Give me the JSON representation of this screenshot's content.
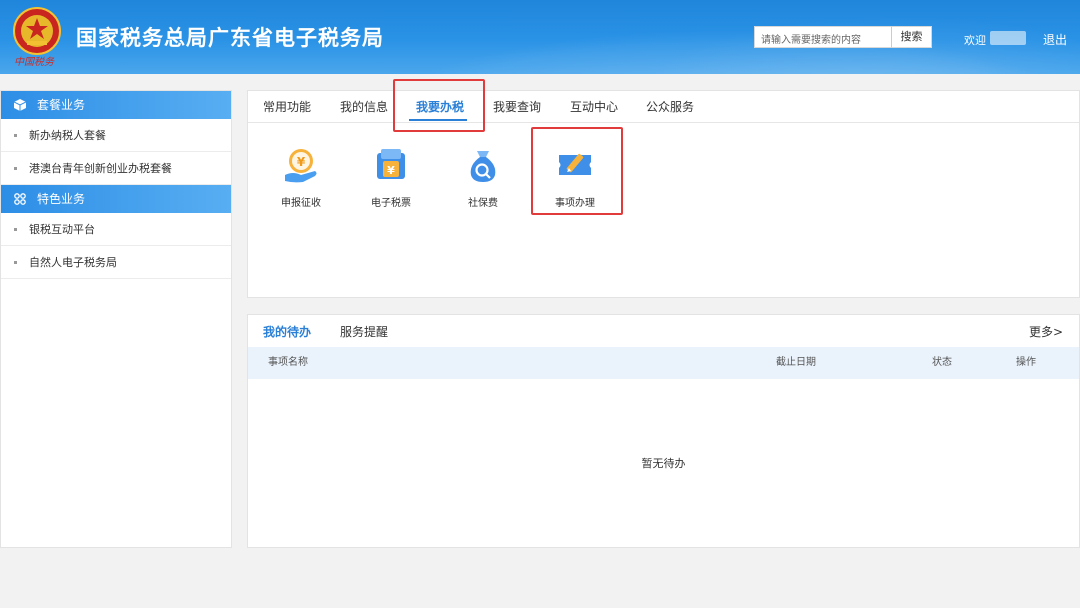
{
  "header": {
    "title": "国家税务总局广东省电子税务局",
    "search_placeholder": "请输入需要搜索的内容",
    "search_button": "搜索",
    "welcome": "欢迎",
    "logout": "退出",
    "emblem_caption": "中国税务"
  },
  "sidebar": {
    "sections": [
      {
        "title": "套餐业务",
        "icon": "cube-icon",
        "items": [
          "新办纳税人套餐",
          "港澳台青年创新创业办税套餐"
        ]
      },
      {
        "title": "特色业务",
        "icon": "grid-icon",
        "items": [
          "银税互动平台",
          "自然人电子税务局"
        ]
      }
    ]
  },
  "main": {
    "tabs": [
      "常用功能",
      "我的信息",
      "我要办税",
      "我要查询",
      "互动中心",
      "公众服务"
    ],
    "active_tab": "我要办税",
    "functions": [
      {
        "label": "申报征收",
        "icon": "yen-hand-icon"
      },
      {
        "label": "电子税票",
        "icon": "tax-ticket-icon"
      },
      {
        "label": "社保费",
        "icon": "money-bag-icon"
      },
      {
        "label": "事项办理",
        "icon": "pencil-ticket-icon"
      }
    ]
  },
  "todo": {
    "tabs": [
      "我的待办",
      "服务提醒"
    ],
    "more": "更多>",
    "columns": [
      "事项名称",
      "截止日期",
      "状态",
      "操作"
    ],
    "empty_text": "暂无待办"
  },
  "colors": {
    "accent": "#2a7fd6",
    "highlight": "#e23b3b",
    "header": "#1f86db"
  }
}
